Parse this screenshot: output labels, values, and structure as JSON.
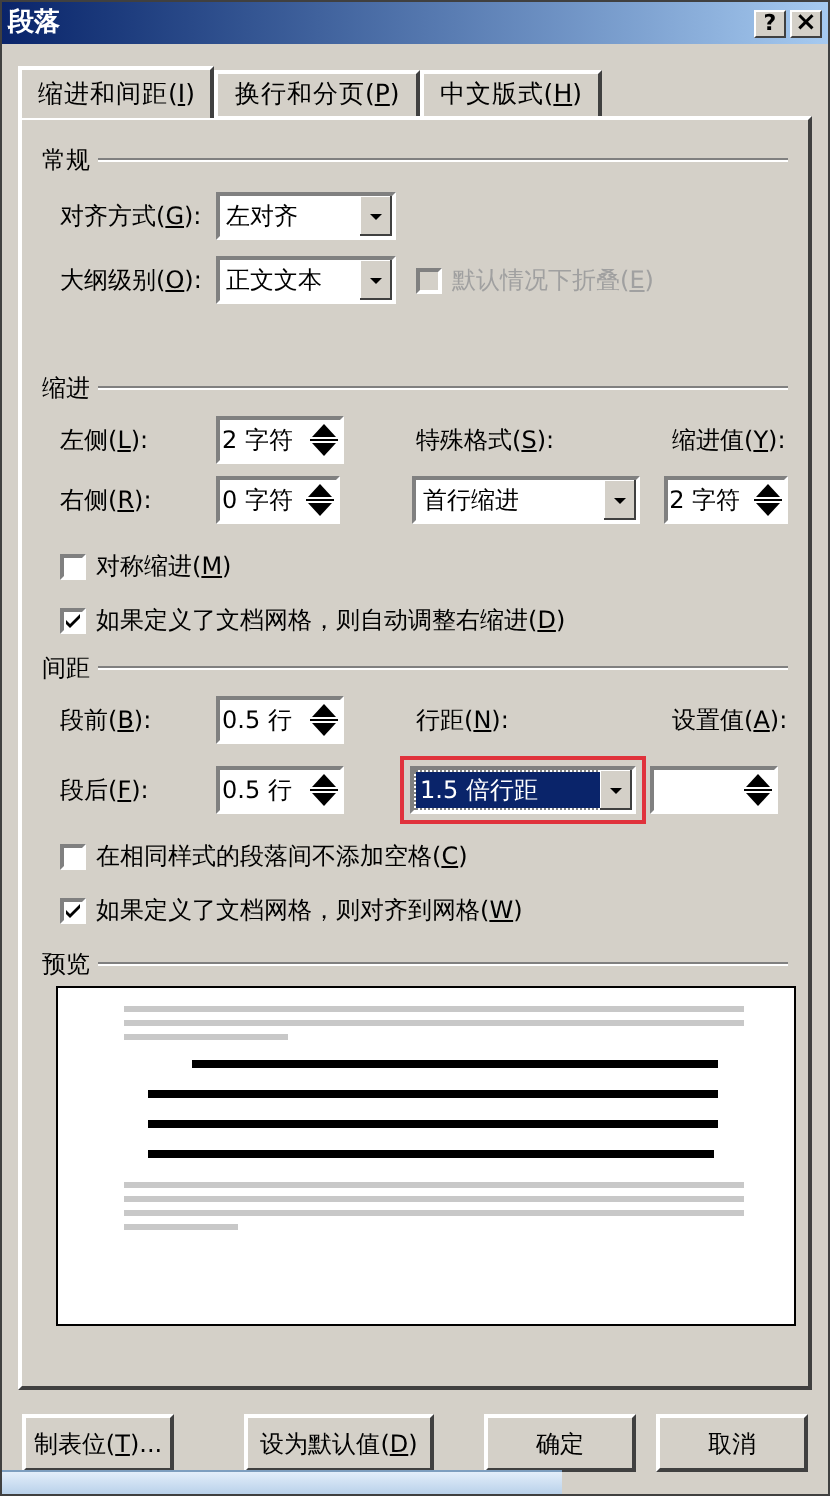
{
  "window": {
    "title": "段落",
    "help": "?",
    "close": "×"
  },
  "tabs": [
    {
      "label": "缩进和间距(I)",
      "selected": true
    },
    {
      "label": "换行和分页(P)",
      "selected": false
    },
    {
      "label": "中文版式(H)",
      "selected": false
    }
  ],
  "general": {
    "title": "常规",
    "alignment": {
      "label": "对齐方式(G):",
      "value": "左对齐"
    },
    "outline_level": {
      "label": "大纲级别(O):",
      "value": "正文文本"
    },
    "collapse": {
      "label": "默认情况下折叠(E)",
      "checked": false,
      "disabled": true
    }
  },
  "indent": {
    "title": "缩进",
    "left": {
      "label": "左侧(L):",
      "value": "2 字符"
    },
    "right": {
      "label": "右侧(R):",
      "value": "0 字符"
    },
    "special": {
      "label": "特殊格式(S):",
      "value": "首行缩进"
    },
    "by": {
      "label": "缩进值(Y):",
      "value": "2 字符"
    },
    "mirror": {
      "label": "对称缩进(M)",
      "checked": false,
      "disabled": false
    },
    "auto_adjust": {
      "label": "如果定义了文档网格，则自动调整右缩进(D)",
      "checked": true,
      "disabled": false
    }
  },
  "spacing": {
    "title": "间距",
    "before": {
      "label": "段前(B):",
      "value": "0.5 行"
    },
    "after": {
      "label": "段后(F):",
      "value": "0.5 行"
    },
    "line_spacing": {
      "label": "行距(N):",
      "value": "1.5 倍行距",
      "selected": true,
      "annotated": true
    },
    "at": {
      "label": "设置值(A):"
    },
    "no_space": {
      "label": "在相同样式的段落间不添加空格(C)",
      "checked": false,
      "disabled": false
    },
    "snap": {
      "label": "如果定义了文档网格，则对齐到网格(W)",
      "checked": true,
      "disabled": false
    }
  },
  "preview": {
    "title": "预览"
  },
  "buttons": [
    {
      "label": "制表位(T)..."
    },
    {
      "label": "设为默认值(D)"
    },
    {
      "label": "确定"
    },
    {
      "label": "取消"
    }
  ]
}
